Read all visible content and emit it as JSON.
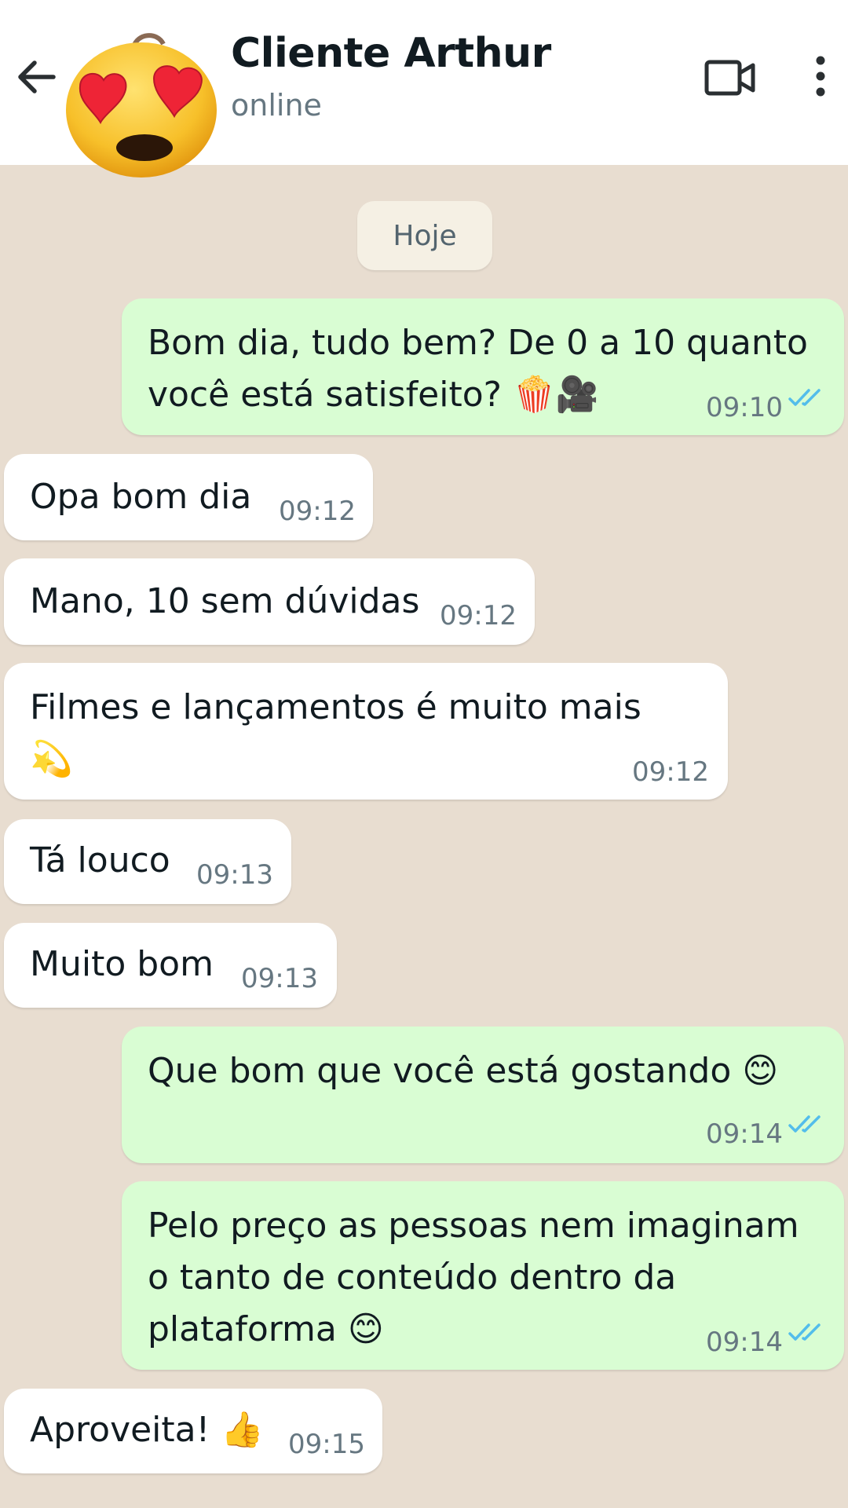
{
  "header": {
    "title": "Cliente Arthur",
    "status": "online"
  },
  "icons": {
    "back": "arrow-left-icon",
    "avatar": "heart-eyes-emoji-avatar",
    "video": "video-call-icon",
    "menu": "more-vertical-icon",
    "read": "double-check-read-icon"
  },
  "colors": {
    "header_bg": "#ffffff",
    "chat_bg": "#e8ddd0",
    "outgoing_bg": "#d9fdd3",
    "incoming_bg": "#ffffff",
    "read_tick": "#53bdeb",
    "meta_text": "#667781"
  },
  "chat": {
    "date_label": "Hoje",
    "messages": [
      {
        "direction": "out",
        "lines": [
          "Bom dia, tudo bem? De 0 a 10 quanto",
          "você está satisfeito? 🍿🎥"
        ],
        "time": "09:10",
        "read": true
      },
      {
        "direction": "in",
        "lines": [
          "Opa bom dia"
        ],
        "time": "09:12"
      },
      {
        "direction": "in",
        "lines": [
          "Mano, 10 sem dúvidas"
        ],
        "time": "09:12"
      },
      {
        "direction": "in",
        "lines": [
          "Filmes e lançamentos é muito mais",
          "💫"
        ],
        "time": "09:12"
      },
      {
        "direction": "in",
        "lines": [
          "Tá louco"
        ],
        "time": "09:13"
      },
      {
        "direction": "in",
        "lines": [
          "Muito bom"
        ],
        "time": "09:13"
      },
      {
        "direction": "out",
        "lines": [
          "Que bom que você está gostando 😊"
        ],
        "time": "09:14",
        "read": true
      },
      {
        "direction": "out",
        "lines": [
          "Pelo preço as pessoas nem imaginam",
          "o tanto de conteúdo dentro da",
          "plataforma 😊"
        ],
        "time": "09:14",
        "read": true
      },
      {
        "direction": "in",
        "lines": [
          "Aproveita! 👍"
        ],
        "time": "09:15"
      }
    ]
  }
}
